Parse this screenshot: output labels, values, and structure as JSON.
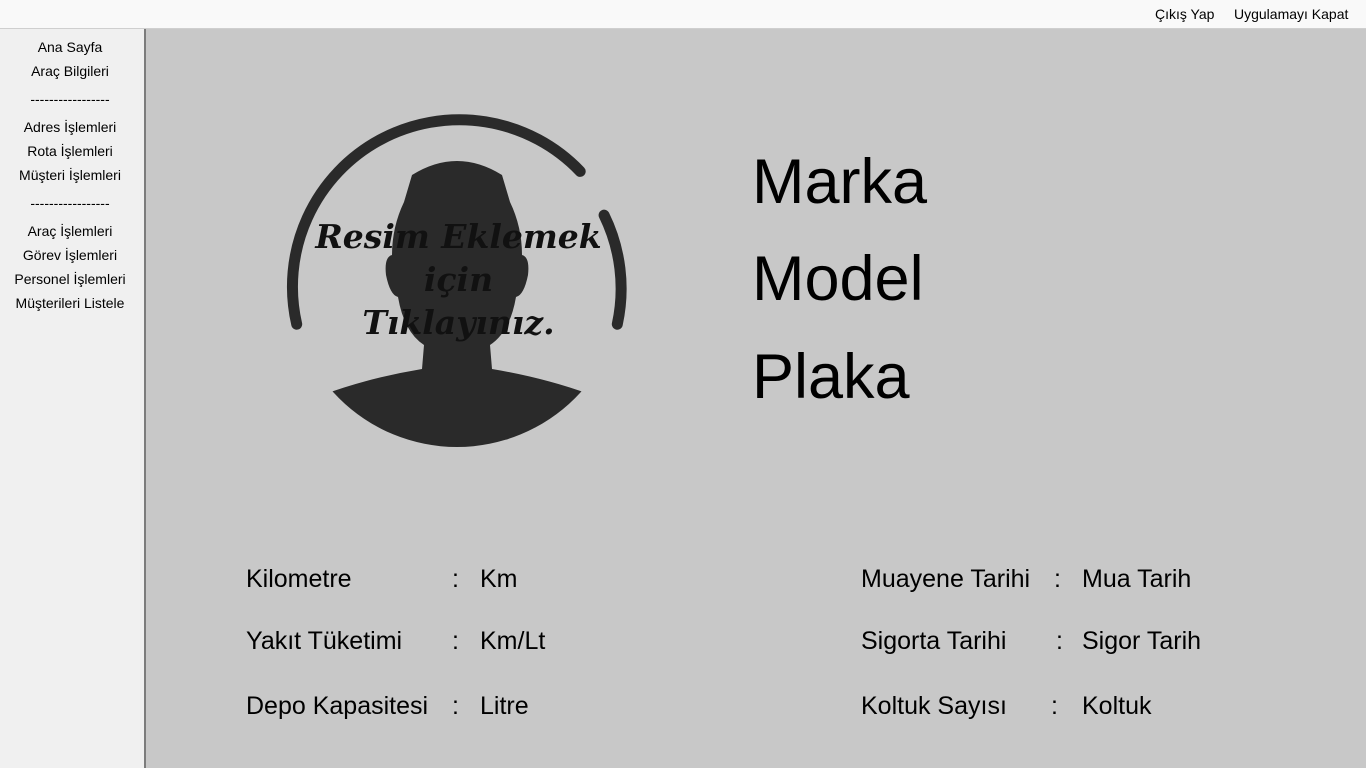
{
  "topbar": {
    "logout_label": "Çıkış Yap",
    "close_app_label": "Uygulamayı Kapat"
  },
  "sidebar": {
    "items": [
      {
        "label": "Ana Sayfa"
      },
      {
        "label": "Araç Bilgileri"
      },
      {
        "label": "Adres İşlemleri"
      },
      {
        "label": "Rota İşlemleri"
      },
      {
        "label": "Müşteri İşlemleri"
      },
      {
        "label": "Araç İşlemleri"
      },
      {
        "label": "Görev İşlemleri"
      },
      {
        "label": "Personel İşlemleri"
      },
      {
        "label": "Müşterileri Listele"
      }
    ],
    "separator": "-----------------"
  },
  "avatar": {
    "icon": "user-silhouette-icon",
    "caption_lines": [
      "Resim Eklemek",
      "için",
      "Tıklayınız."
    ]
  },
  "vehicle": {
    "brand": "Marka",
    "model": "Model",
    "plate": "Plaka"
  },
  "details_left": [
    {
      "label": "Kilometre",
      "colon": ":",
      "value": "Km"
    },
    {
      "label": "Yakıt Tüketimi",
      "colon": ":",
      "value": "Km/Lt"
    },
    {
      "label": "Depo Kapasitesi",
      "colon": ":",
      "value": "Litre"
    }
  ],
  "details_right": [
    {
      "label": "Muayene Tarihi",
      "colon": ":",
      "value": "Mua Tarih"
    },
    {
      "label": "Sigorta Tarihi",
      "colon": ":",
      "value": "Sigor Tarih"
    },
    {
      "label": "Koltuk Sayısı",
      "colon": ":",
      "value": "Koltuk"
    }
  ],
  "colors": {
    "main_bg": "#c8c8c8",
    "sidebar_bg": "#f0f0f0",
    "icon": "#2a2a2a"
  }
}
